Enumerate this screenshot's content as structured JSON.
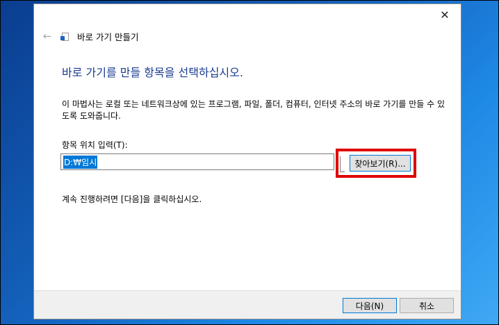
{
  "window": {
    "title": "바로 가기 만들기",
    "close_glyph": "✕",
    "back_glyph": "←"
  },
  "main": {
    "heading": "바로 가기를 만들 항목을 선택하십시오.",
    "description": "이 마법사는 로컬 또는 네트워크상에 있는 프로그램, 파일, 폴더, 컴퓨터, 인터넷 주소의 바로 가기를 만들 수 있도록 도와줍니다.",
    "location_label": "항목 위치 입력(T):",
    "location_value": "D:₩임시",
    "browse_label": "찾아보기(R)...",
    "continue_text": "계속 진행하려면 [다음]을 클릭하십시오."
  },
  "footer": {
    "next_label": "다음(N)",
    "cancel_label": "취소"
  },
  "colors": {
    "heading": "#1a3a8f",
    "highlight": "#e00000",
    "selection": "#0078d7"
  }
}
